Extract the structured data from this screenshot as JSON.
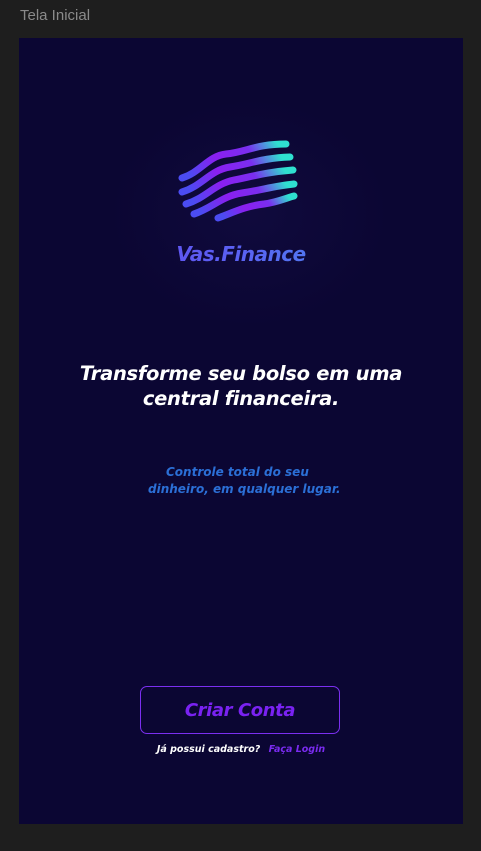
{
  "frame": {
    "label": "Tela Inicial"
  },
  "brand": {
    "name": "Vas.Finance",
    "logo_icon": "wavy-stripes-logo-icon",
    "gradient": [
      "#6a3cf0",
      "#3fa2ef"
    ]
  },
  "hero": {
    "headline": "Transforme seu bolso em uma central financeira.",
    "subtitle_line1": "Controle total do seu",
    "subtitle_line2": "dinheiro, em qualquer lugar."
  },
  "actions": {
    "create_account_label": "Criar Conta",
    "login_prompt": "Já possui cadastro?",
    "login_link": "Faça Login"
  },
  "colors": {
    "background": "#0b0633",
    "accent_purple": "#7a22f2",
    "subtitle_blue": "#2b6fd6"
  }
}
